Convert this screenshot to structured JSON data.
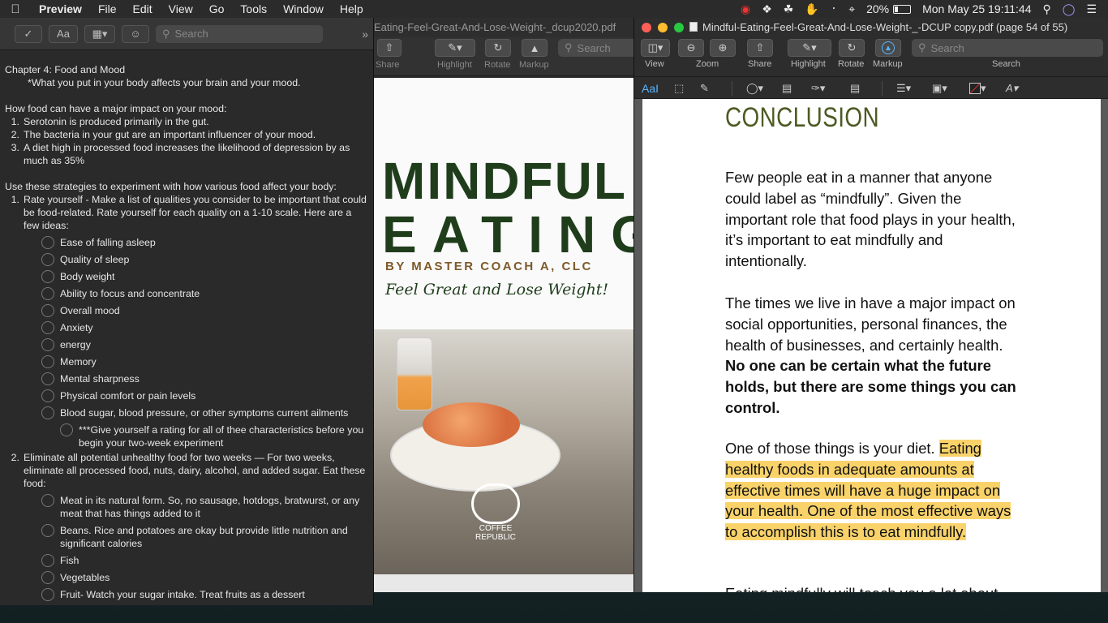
{
  "menubar": {
    "app_name": "Preview",
    "items": [
      "File",
      "Edit",
      "View",
      "Go",
      "Tools",
      "Window",
      "Help"
    ],
    "battery_percent": "20%",
    "datetime": "Mon May 25  19:11:44"
  },
  "notes": {
    "search_placeholder": "Search",
    "chapter_title": "Chapter 4: Food and Mood",
    "chapter_sub": "*What you put in your body affects your brain and your mood.",
    "impact_heading": "How food can have a major impact on your mood:",
    "impact_items": [
      {
        "n": "1.",
        "text": "Serotonin is produced primarily in the gut."
      },
      {
        "n": "2.",
        "text": "The bacteria in your gut are an important influencer of your mood."
      },
      {
        "n": "3.",
        "text": "A diet high in processed food increases the likelihood of depression by as much as 35%"
      }
    ],
    "strategies_heading": "Use these strategies to experiment with how various food affect your body:",
    "strategy1": {
      "n": "1.",
      "text": "Rate yourself - Make a list of qualities you consider to be important that could be food-related. Rate yourself for each quality on a 1-10 scale. Here are a few ideas:"
    },
    "checklist1": [
      "Ease of falling asleep",
      "Quality of sleep",
      "Body weight",
      "Ability to focus and concentrate",
      "Overall mood",
      "Anxiety",
      "energy",
      "Memory",
      "Mental sharpness",
      "Physical comfort or pain levels",
      "Blood sugar, blood pressure, or other symptoms current ailments"
    ],
    "sub_check": "***Give yourself a rating for all of thee characteristics before you begin your two-week experiment",
    "strategy2": {
      "n": "2.",
      "text": "Eliminate all potential unhealthy food for two weeks — For two weeks, eliminate all processed food, nuts, dairy, alcohol, and added sugar. Eat these food:"
    },
    "checklist2": [
      "Meat in its natural form. So, no sausage, hotdogs, bratwurst, or any meat that has things added to it",
      "Beans. Rice and potatoes are okay but provide little nutrition and significant calories",
      "Fish",
      "Vegetables",
      "Fruit- Watch your sugar intake. Treat fruits as a dessert"
    ]
  },
  "mid_window": {
    "title": "Eating-Feel-Great-And-Lose-Weight-_dcup2020.pdf",
    "toolbar_labels": [
      "Share",
      "Highlight",
      "Rotate",
      "Markup"
    ],
    "search_placeholder": "Search",
    "cover": {
      "title_line1": "MINDFUL",
      "title_line2": "EATING",
      "byline": "BY MASTER COACH A, CLC",
      "subtitle": "Feel Great and Lose Weight!",
      "logo_text": "COFFEE REPUBLIC"
    }
  },
  "right_window": {
    "title": "Mindful-Eating-Feel-Great-And-Lose-Weight-_-DCUP copy.pdf (page 54 of 55)",
    "toolbar": {
      "view": "View",
      "zoom": "Zoom",
      "share": "Share",
      "highlight": "Highlight",
      "rotate": "Rotate",
      "markup": "Markup",
      "search": "Search",
      "search_placeholder": "Search"
    },
    "page": {
      "heading": "CONCLUSION",
      "p1": "Few people eat in a manner that anyone could label as “mindfully”. Given the important role that food plays in your health, it’s important to eat mindfully and intentionally.",
      "p2_normal": "The times we live in have a major impact on social opportunities, personal finances, the health of businesses, and certainly health. ",
      "p2_bold": "No one can be certain what the future holds, but there are some things you can control.",
      "p3_normal": "One of those things is your diet. ",
      "p3_highlight": "Eating healthy foods in adequate amounts at effective times will have a huge impact on your health. One of the most effective ways to accomplish this is to eat mindfully.",
      "p4": "Eating mindfully will teach you a lot about"
    }
  },
  "colors": {
    "highlight": "#f9d36a",
    "heading": "#4d5a22",
    "cover_green": "#1f3d1b",
    "cover_brown": "#7d5a2a"
  }
}
